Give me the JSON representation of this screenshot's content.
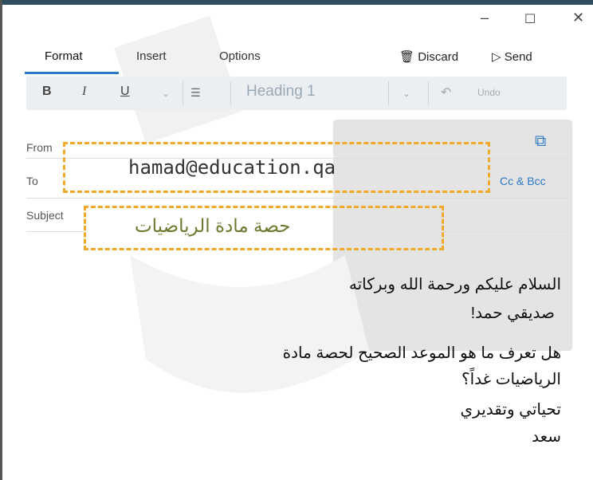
{
  "window": {
    "minimize": "–",
    "maximize": "☐",
    "close": "✕"
  },
  "tabs": [
    {
      "label": "Format"
    },
    {
      "label": "Insert"
    },
    {
      "label": "Options"
    }
  ],
  "actions": {
    "discard": "Discard",
    "send": "Send"
  },
  "toolbar": {
    "bold": "B",
    "italic": "I",
    "underline": "U",
    "style_value": "Heading 1",
    "undo": "Undo"
  },
  "fields": {
    "from_label": "From",
    "to_label": "To",
    "subject_label": "Subject",
    "to_value": "hamad@education.qa",
    "subject_value": "حصة مادة الرياضيات",
    "cc_bcc": "Cc & Bcc"
  },
  "body": [
    "السلام عليكم ورحمة الله وبركاته",
    "صديقي حمد!",
    "هل تعرف ما هو الموعد الصحيح لحصة مادة",
    "الرياضيات غداً؟",
    "تحياتي وتقديري",
    "سعد"
  ],
  "colors": {
    "accent": "#2a78c8",
    "highlight_border": "#f0a92a",
    "subject_text": "#6b7a2f"
  }
}
